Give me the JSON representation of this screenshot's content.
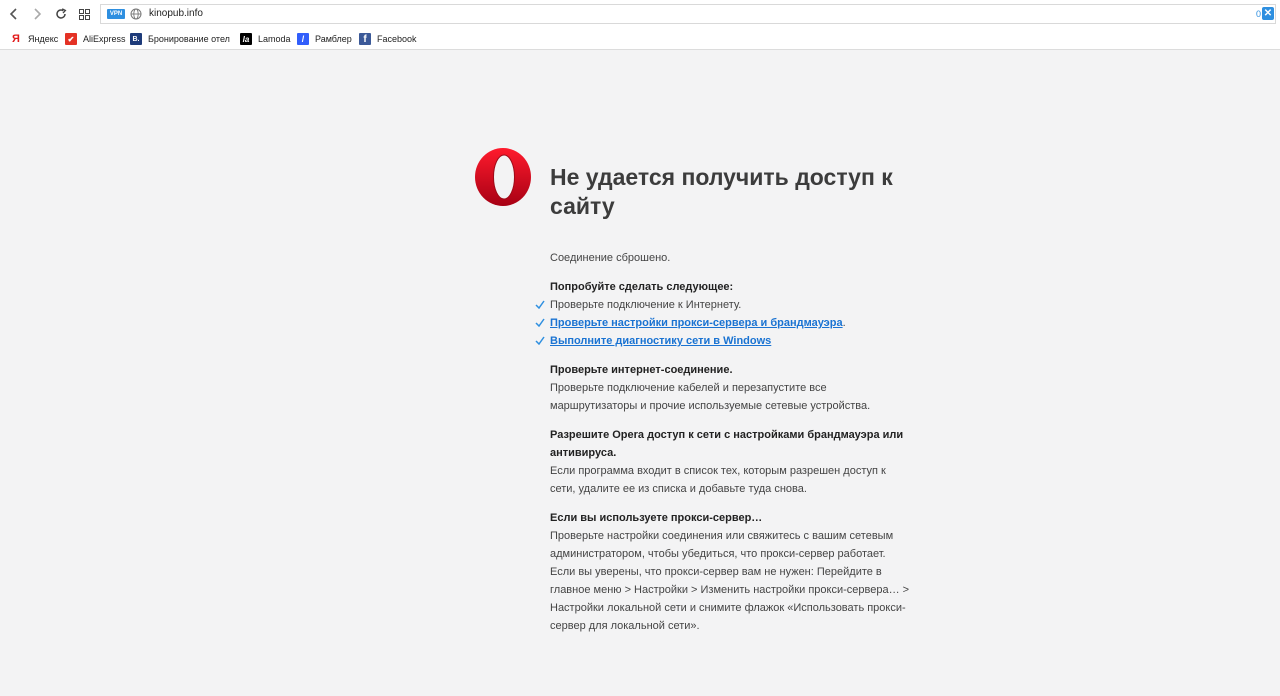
{
  "browser": {
    "url": "kinopub.info",
    "vpn_label": "VPN",
    "counter": "0",
    "extension_symbol": "✕"
  },
  "bookmarks": [
    {
      "icon_text": "Я",
      "label": "Яндекс",
      "icon_color": "#e21b1b"
    },
    {
      "icon_text": "✔",
      "label": "AliExpress",
      "icon_color": "#e43225"
    },
    {
      "icon_text": "B.",
      "label": "Бронирование отел",
      "icon_color": "#1e3b7a"
    },
    {
      "icon_text": "la",
      "label": "Lamoda",
      "icon_color": "#000000"
    },
    {
      "icon_text": "/",
      "label": "Рамблер",
      "icon_color": "#315efb"
    },
    {
      "icon_text": "f",
      "label": "Facebook",
      "icon_color": "#3b5998"
    }
  ],
  "error": {
    "title": "Не удается получить доступ к сайту",
    "subtitle": "Соединение сброшено.",
    "try_heading": "Попробуйте сделать следующее:",
    "try_items": [
      {
        "text": "Проверьте подключение к Интернету.",
        "is_link": false
      },
      {
        "text": "Проверьте настройки прокси-сервера и брандмауэра",
        "is_link": true,
        "suffix": "."
      },
      {
        "text": "Выполните диагностику сети в Windows",
        "is_link": true,
        "suffix": ""
      }
    ],
    "sections": [
      {
        "heading": "Проверьте интернет-соединение.",
        "body": "Проверьте подключение кабелей и перезапустите все маршрутизаторы и прочие используемые сетевые устройства."
      },
      {
        "heading": "Разрешите Opera доступ к сети с настройками брандмауэра или антивируса.",
        "body": "Если программа входит в список тех, которым разрешен доступ к сети, удалите ее из списка и добавьте туда снова."
      },
      {
        "heading": "Если вы используете прокси-сервер…",
        "body": "Проверьте настройки соединения или свяжитесь с вашим сетевым администратором, чтобы убедиться, что прокси-сервер работает. Если вы уверены, что прокси-сервер вам не нужен: Перейдите в главное меню > Настройки > Изменить настройки прокси-сервера… > Настройки локальной сети и снимите флажок «Использовать прокси-сервер для локальной сети»."
      }
    ]
  },
  "colors": {
    "accent": "#2e8fe0",
    "link": "#1a73d2",
    "opera_red": "#d61d2e",
    "page_bg": "#f3f3f4"
  }
}
